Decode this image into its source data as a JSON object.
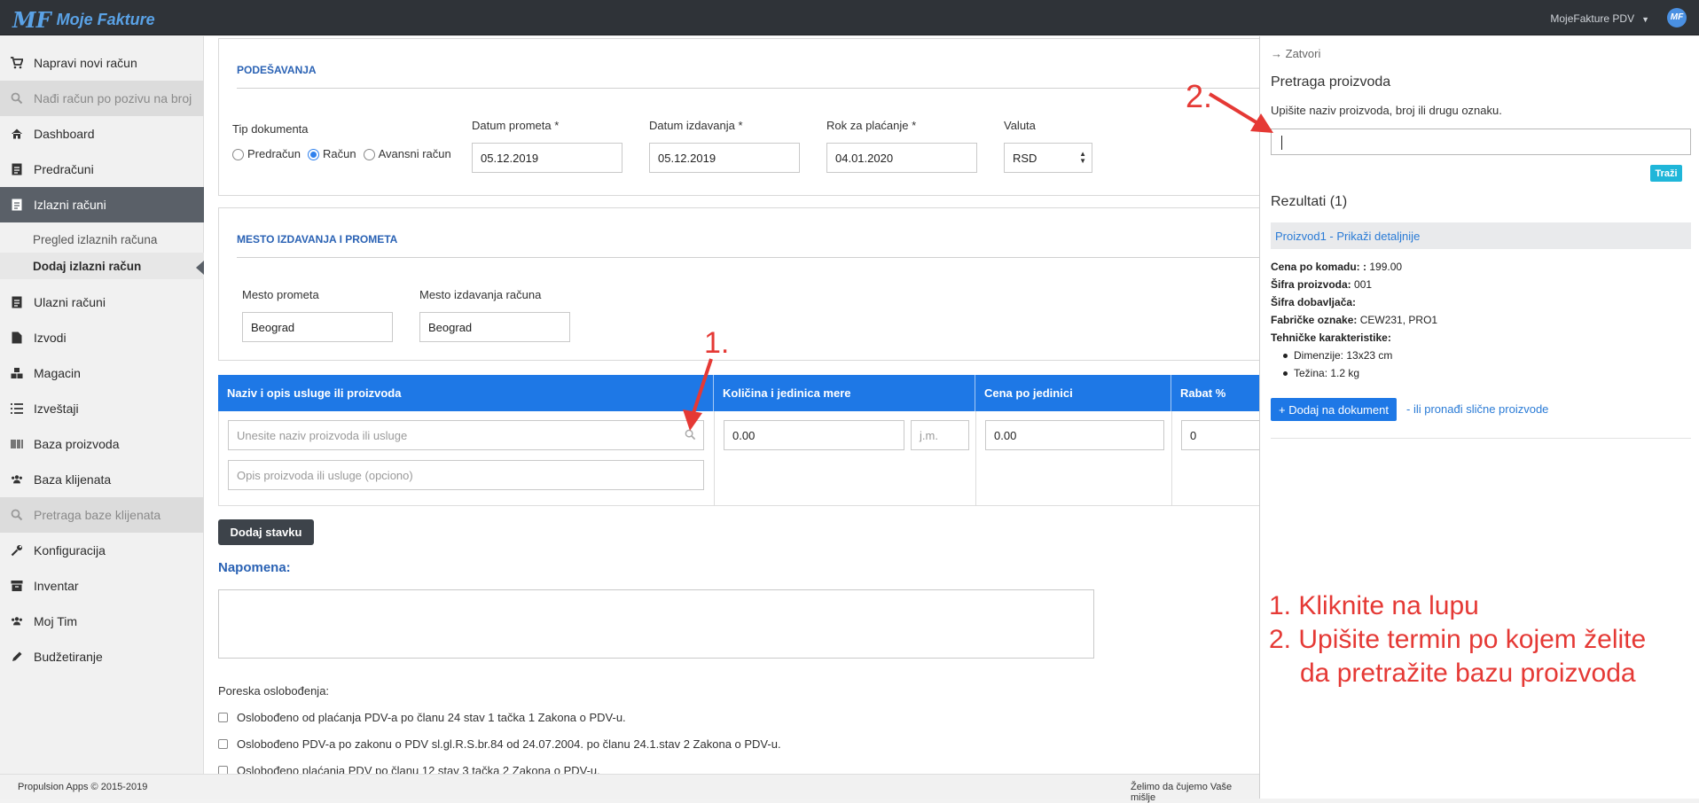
{
  "app": {
    "name": "Moje Fakture",
    "logo_mark": "MF",
    "account": "MojeFakture PDV",
    "avatar": "MF"
  },
  "sidebar": {
    "items": [
      {
        "label": "Napravi novi račun",
        "icon": "cart-icon"
      },
      {
        "label": "Nađi račun po pozivu na broj",
        "icon": "search-icon"
      },
      {
        "label": "Dashboard",
        "icon": "home-icon"
      },
      {
        "label": "Predračuni",
        "icon": "document-icon"
      },
      {
        "label": "Izlazni računi",
        "icon": "document-icon"
      },
      {
        "label": "Ulazni računi",
        "icon": "document-icon"
      },
      {
        "label": "Izvodi",
        "icon": "file-icon"
      },
      {
        "label": "Magacin",
        "icon": "cubes-icon"
      },
      {
        "label": "Izveštaji",
        "icon": "list-icon"
      },
      {
        "label": "Baza proizvoda",
        "icon": "barcode-icon"
      },
      {
        "label": "Baza klijenata",
        "icon": "users-icon"
      },
      {
        "label": "Pretraga baze klijenata",
        "icon": "search-icon"
      },
      {
        "label": "Konfiguracija",
        "icon": "wrench-icon"
      },
      {
        "label": "Inventar",
        "icon": "archive-icon"
      },
      {
        "label": "Moj Tim",
        "icon": "users-icon"
      },
      {
        "label": "Budžetiranje",
        "icon": "pencil-icon"
      }
    ],
    "subitems": [
      {
        "label": "Pregled izlaznih računa"
      },
      {
        "label": "Dodaj izlazni račun"
      }
    ]
  },
  "settings": {
    "title": "PODEŠAVANJA",
    "doc_type_label": "Tip dokumenta",
    "doc_types": [
      "Predračun",
      "Račun",
      "Avansni račun"
    ],
    "selected_doc_type": "Račun",
    "datum_prometa_label": "Datum prometa *",
    "datum_prometa": "05.12.2019",
    "datum_izdavanja_label": "Datum izdavanja *",
    "datum_izdavanja": "05.12.2019",
    "rok_label": "Rok za plaćanje *",
    "rok": "04.01.2020",
    "valuta_label": "Valuta",
    "valuta": "RSD"
  },
  "location": {
    "title": "MESTO IZDAVANJA I PROMETA",
    "mesto_prometa_label": "Mesto prometa",
    "mesto_prometa": "Beograd",
    "mesto_izdavanja_label": "Mesto izdavanja računa",
    "mesto_izdavanja": "Beograd"
  },
  "items_table": {
    "headers": [
      "Naziv i opis usluge ili proizvoda",
      "Količina i jedinica mere",
      "Cena po jedinici",
      "Rabat %"
    ],
    "name_placeholder": "Unesite naziv proizvoda ili usluge",
    "desc_placeholder": "Opis proizvoda ili usluge (opciono)",
    "qty": "0.00",
    "unit_placeholder": "j.m.",
    "price": "0.00",
    "rabat": "0"
  },
  "add_item_button": "Dodaj stavku",
  "note_label": "Napomena:",
  "tax": {
    "label": "Poreska oslobođenja:",
    "options": [
      "Oslobođeno od plaćanja PDV-a po članu 24 stav 1 tačka 1 Zakona o PDV-u.",
      "Oslobođeno PDV-a po zakonu o PDV sl.gl.R.S.br.84 od 24.07.2004. po članu 24.1.stav 2 Zakona o PDV-u.",
      "Oslobođeno plaćanja PDV po članu 12 stav 3 tačka 2 Zakona o PDV-u."
    ]
  },
  "footer": {
    "copyright": "Propulsion Apps © 2015-2019",
    "message": "Želimo da čujemo Vaše mišlje"
  },
  "search_panel": {
    "close": "Zatvori",
    "title": "Pretraga proizvoda",
    "hint": "Upišite naziv proizvoda, broj ili drugu oznaku.",
    "search_button": "Traži",
    "results_title": "Rezultati (1)",
    "result_link": "Proizvod1 - Prikaži detaljnije",
    "details": [
      {
        "label": "Cena po komadu: :",
        "value": " 199.00"
      },
      {
        "label": "Šifra proizvoda:",
        "value": " 001"
      },
      {
        "label": "Šifra dobavljača:",
        "value": ""
      },
      {
        "label": "Fabričke oznake:",
        "value": " CEW231, PRO1"
      },
      {
        "label": "Tehničke karakteristike:",
        "value": ""
      }
    ],
    "specs": [
      "Dimenzije: 13x23 cm",
      "Težina: 1.2 kg"
    ],
    "add_button": "+ Dodaj na dokument",
    "similar_link": "- ili pronađi slične proizvode"
  },
  "annotations": {
    "marker1": "1.",
    "marker2": "2.",
    "instruction1": "1. Kliknite na lupu",
    "instruction2": "2. Upišite termin po kojem želite",
    "instruction3": "da pretražite bazu proizvoda",
    "color": "#e53935"
  },
  "colors": {
    "accent": "#1e78e6",
    "topbar": "#2f3338",
    "sidebar_active": "#5a6068",
    "teal_button": "#1fb6d9"
  }
}
